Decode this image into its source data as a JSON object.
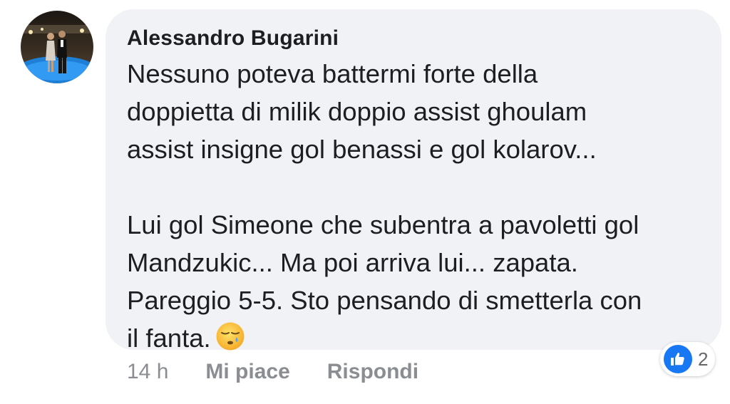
{
  "comment": {
    "author": "Alessandro Bugarini",
    "lines": [
      "Nessuno poteva battermi forte della",
      "doppietta di milik doppio assist ghoulam",
      "assist insigne gol benassi e gol kolarov...",
      "Lui gol Simeone che subentra a pavoletti gol",
      "Mandzukic... Ma poi arriva lui... zapata.",
      "Pareggio 5-5. Sto pensando di smetterla con",
      "il fanta."
    ],
    "emoji": "sleepy-face"
  },
  "meta": {
    "time": "14 h",
    "like_label": "Mi piace",
    "reply_label": "Rispondi"
  },
  "reactions": {
    "icon": "like-icon",
    "count": "2"
  },
  "colors": {
    "bubble": "#f0f2f5",
    "text": "#1c1e21",
    "meta": "#8a8d91",
    "like_blue": "#1877f2"
  }
}
